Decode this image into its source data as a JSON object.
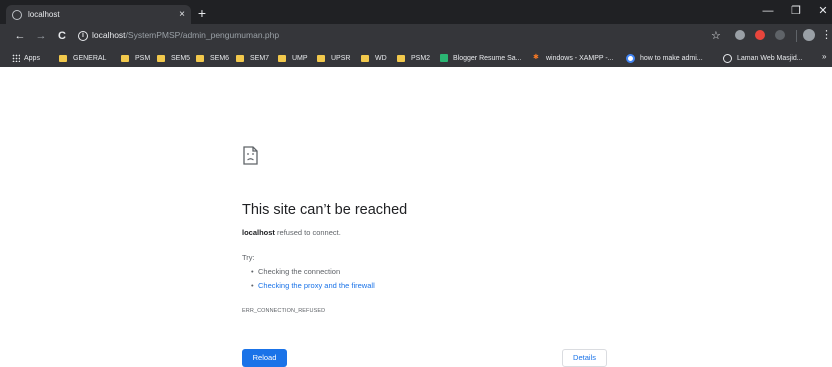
{
  "window": {
    "minimize_label": "—",
    "maximize_label": "❐",
    "close_label": "✕"
  },
  "tab": {
    "title": "localhost",
    "favicon": "globe-icon",
    "close_label": "×"
  },
  "new_tab_label": "+",
  "toolbar": {
    "back_label": "←",
    "forward_label": "→",
    "reload_label": "C",
    "url_host": "localhost",
    "url_path": "/SystemPMSP/admin_pengumuman.php",
    "star_label": "☆",
    "menu_label": "⋮"
  },
  "bookmarks": {
    "items": [
      {
        "label": "Apps",
        "icon": "apps-icon"
      },
      {
        "label": "GENERAL",
        "icon": "folder-icon"
      },
      {
        "label": "PSM",
        "icon": "folder-icon"
      },
      {
        "label": "SEM5",
        "icon": "folder-icon"
      },
      {
        "label": "SEM6",
        "icon": "folder-icon"
      },
      {
        "label": "SEM7",
        "icon": "folder-icon"
      },
      {
        "label": "UMP",
        "icon": "folder-icon"
      },
      {
        "label": "UPSR",
        "icon": "folder-icon"
      },
      {
        "label": "WD",
        "icon": "folder-icon"
      },
      {
        "label": "PSM2",
        "icon": "folder-icon"
      },
      {
        "label": "Blogger Resume Sa...",
        "icon": "blogger-icon"
      },
      {
        "label": "windows - XAMPP -...",
        "icon": "xampp-icon"
      },
      {
        "label": "how to make admi...",
        "icon": "google-icon"
      },
      {
        "label": "Laman Web Masjid...",
        "icon": "globe-icon"
      }
    ],
    "more_label": "»"
  },
  "error_page": {
    "icon": "sad-document-icon",
    "title": "This site can’t be reached",
    "host": "localhost",
    "message": " refused to connect.",
    "try_label": "Try:",
    "suggestions": [
      "Checking the connection",
      "Checking the proxy and the firewall"
    ],
    "error_code": "ERR_CONNECTION_REFUSED",
    "reload_button": "Reload",
    "details_button": "Details"
  },
  "colors": {
    "chrome_dark": "#202124",
    "toolbar_dark": "#35363a",
    "folder_yellow": "#f2c94c",
    "link_blue": "#1a73e8",
    "text_gray": "#5f6368"
  }
}
